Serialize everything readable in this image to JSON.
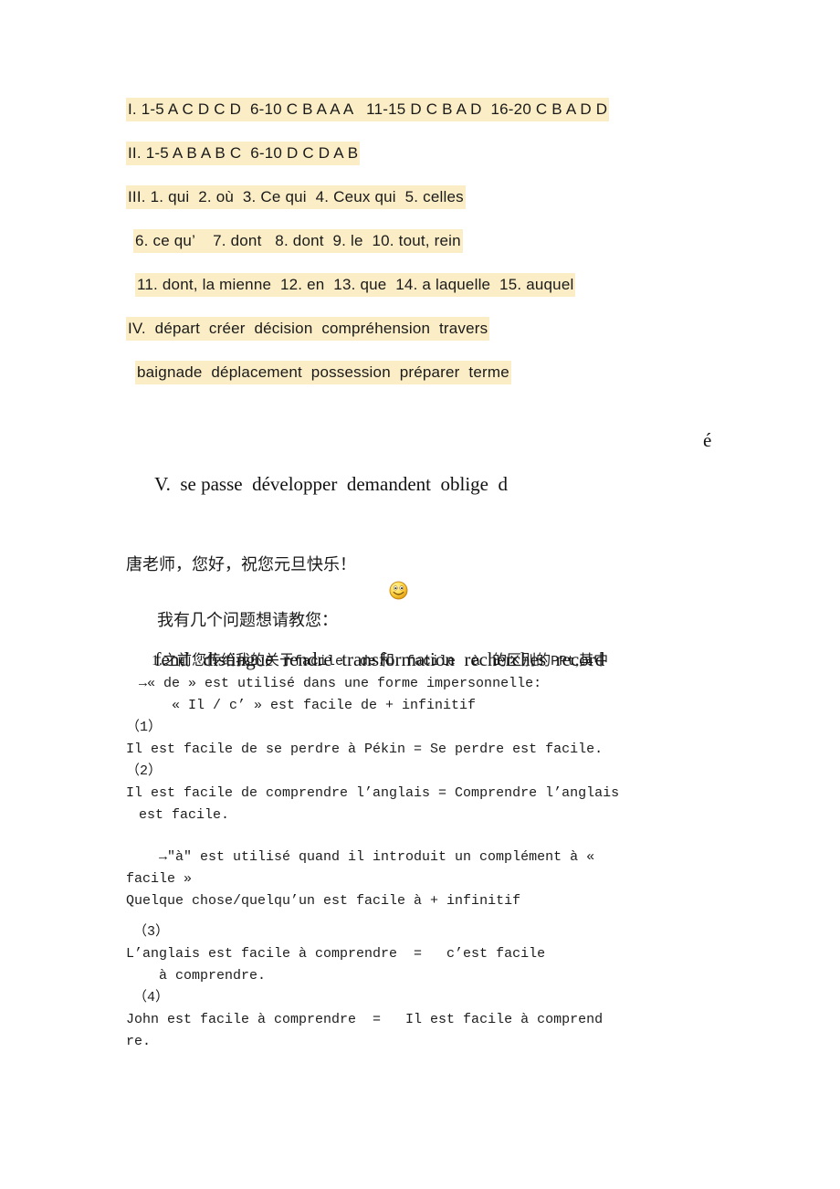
{
  "document": {
    "title": "French exercise answer key and questions",
    "highlight_color": "#fbeec6",
    "text_color": "#1a1a1a",
    "background_color": "#ffffff"
  },
  "answers": {
    "lines": [
      {
        "id": "section-i",
        "text": "I. 1-5 A C D C D  6-10 C B A A A   11-15 D C B A D  16-20 C B A D D",
        "indent": 0
      },
      {
        "id": "section-ii",
        "text": "II. 1-5 A B A B C  6-10 D C D A B",
        "indent": 0
      },
      {
        "id": "section-iii-a",
        "text": "III. 1. qui  2. où  3. Ce qui  4. Ceux qui  5. celles",
        "indent": 0
      },
      {
        "id": "section-iii-b",
        "text": "6. ce qu’    7. dont   8. dont  9. le  10. tout, rein",
        "indent": 1
      },
      {
        "id": "section-iii-c",
        "text": "11. dont, la mienne  12. en  13. que  14. a laquelle  15. auquel",
        "indent": 2
      },
      {
        "id": "section-iv-a",
        "text": "IV.  départ  créer  décision  compréhension  travers",
        "indent": 0
      },
      {
        "id": "section-iv-b",
        "text": "baignade  déplacement  possession  préparer  terme",
        "indent": 2
      }
    ]
  },
  "section_v": {
    "line1": "V.  se passe  développer  demandent  oblige  d",
    "line1_tail": "é",
    "line2": "fend   distingue  rendre  transformation  recherches  record"
  },
  "greeting": {
    "salutation": "唐老师，您好，祝您元旦快乐！",
    "emoji_name": "smiley-face-emoji",
    "sub": "我有几个问题想请教您："
  },
  "qa": {
    "question1_head_cn_1": "1.之前您传给我的关于",
    "question1_head_mono_1": "facile  de",
    "question1_head_cn_2": " 和 ",
    "question1_head_mono_2": " facile  à ",
    "question1_head_cn_3": " 的区别的",
    "question1_head_mono_3": "PPt",
    "question1_head_cn_4": ",其中",
    "rule_de": "→« de » est utilisé dans une forme impersonnelle:",
    "rule_de_pattern": "« Il / c’ » est facile de + infinitif",
    "ex1_label": "（1）",
    "ex1_text": "Il est facile de se perdre à Pékin = Se perdre est facile.",
    "ex2_label": "（2）",
    "ex2_text": "Il est facile de comprendre l’anglais = Comprendre l’anglais",
    "ex2_text_cont": "est facile.",
    "rule_a": "→\"à\" est utilisé quand il introduit un complément à «",
    "rule_a_cont": "facile »",
    "rule_a_pattern": "Quelque chose/quelqu’un est facile à + infinitif",
    "ex3_label": "（3）",
    "ex3_text": "L’anglais est facile à comprendre  =   c’est facile",
    "ex3_text_cont": "à comprendre.",
    "ex4_label": "（4）",
    "ex4_text": "John est facile à comprendre  =   Il est facile à comprend",
    "ex4_text_cont": "re."
  }
}
